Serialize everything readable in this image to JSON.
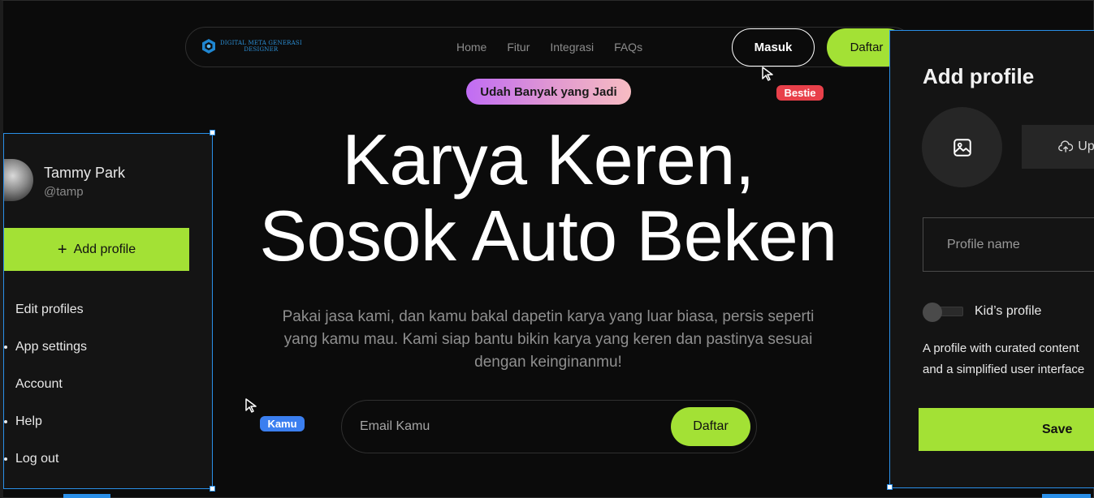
{
  "navbar": {
    "logo_text_line1": "DIGITAL META GENERASI",
    "logo_text_line2": "DESIGNER",
    "links": [
      "Home",
      "Fitur",
      "Integrasi",
      "FAQs"
    ],
    "login_label": "Masuk",
    "register_label": "Daftar"
  },
  "badges": {
    "top_pill": "Udah Banyak yang Jadi",
    "cursor_tag_bestie": "Bestie",
    "cursor_tag_kamu": "Kamu"
  },
  "hero": {
    "title_line1": "Karya Keren,",
    "title_line2": "Sosok Auto Beken",
    "subtitle": "Pakai jasa kami, dan kamu bakal dapetin karya yang luar biasa, persis seperti yang kamu mau. Kami siap bantu bikin karya yang keren dan pastinya sesuai dengan keinginanmu!",
    "email_placeholder": "Email Kamu",
    "cta_label": "Daftar"
  },
  "left_panel": {
    "user_name": "Tammy Park",
    "user_handle": "@tamp",
    "add_profile_label": "Add profile",
    "menu": [
      "Edit profiles",
      "App settings",
      "Account",
      "Help",
      "Log out"
    ]
  },
  "right_panel": {
    "title": "Add profile",
    "upload_label": "Upload",
    "profile_name_placeholder": "Profile name",
    "kids_profile_label": "Kid’s profile",
    "description_line1": "A profile with curated content",
    "description_line2": "and a simplified user interface",
    "save_label": "Save"
  },
  "colors": {
    "accent_green": "#a3e135",
    "selection_blue": "#2a8fe8",
    "bestie_red": "#e8404a",
    "kamu_blue": "#3b7ff0"
  },
  "icons": [
    "logo-icon",
    "cursor-icon",
    "plus-icon",
    "image-icon",
    "upload-cloud-icon"
  ]
}
